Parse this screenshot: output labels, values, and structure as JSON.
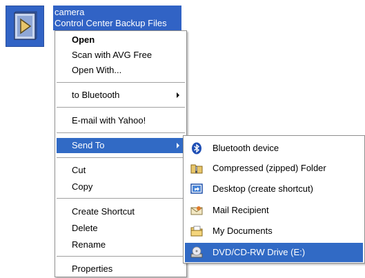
{
  "file": {
    "icon": "video-file-icon",
    "name_line1": "camera",
    "name_line2": "Control Center Backup Files"
  },
  "context_menu": {
    "items": [
      {
        "label": "Open"
      },
      {
        "label": "Scan with AVG Free"
      },
      {
        "label": "Open With..."
      },
      {
        "label": "to Bluetooth"
      },
      {
        "label": "E-mail with Yahoo!"
      },
      {
        "label": "Send To"
      },
      {
        "label": "Cut"
      },
      {
        "label": "Copy"
      },
      {
        "label": "Create Shortcut"
      },
      {
        "label": "Delete"
      },
      {
        "label": "Rename"
      },
      {
        "label": "Properties"
      }
    ]
  },
  "send_to_submenu": {
    "items": [
      {
        "label": "Bluetooth device",
        "icon": "bluetooth-icon"
      },
      {
        "label": "Compressed (zipped) Folder",
        "icon": "zip-folder-icon"
      },
      {
        "label": "Desktop (create shortcut)",
        "icon": "desktop-shortcut-icon"
      },
      {
        "label": "Mail Recipient",
        "icon": "mail-icon"
      },
      {
        "label": "My Documents",
        "icon": "documents-folder-icon"
      },
      {
        "label": "DVD/CD-RW Drive (E:)",
        "icon": "cd-drive-icon"
      }
    ]
  },
  "colors": {
    "selection": "#316ac5"
  }
}
